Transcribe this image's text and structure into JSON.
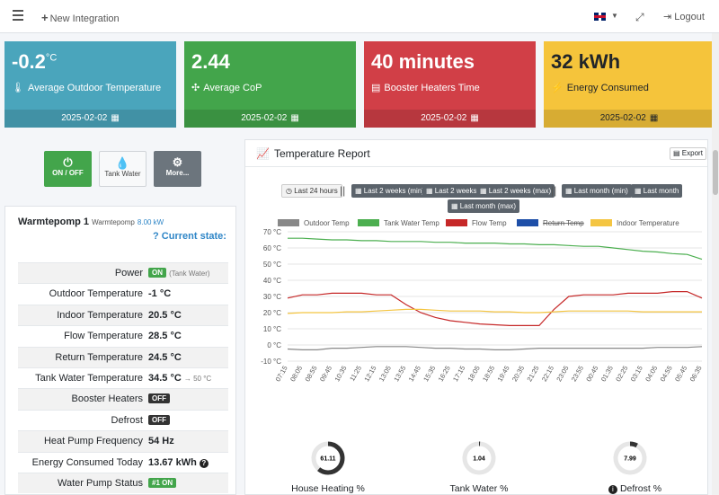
{
  "nav": {
    "new_integration": "New Integration",
    "logout": "Logout"
  },
  "cards": [
    {
      "value": "-0.2",
      "unit": "°C",
      "label": "Average Outdoor Temperature",
      "date": "2025-02-02",
      "color": "#4aa5bc"
    },
    {
      "value": "2.44",
      "unit": "",
      "label": "Average CoP",
      "date": "2025-02-02",
      "color": "#43a54b"
    },
    {
      "value": "40 minutes",
      "unit": "",
      "label": "Booster Heaters Time",
      "date": "2025-02-02",
      "color": "#d13f47"
    },
    {
      "value": "32 kWh",
      "unit": "",
      "label": "Energy Consumed",
      "date": "2025-02-02",
      "color": "#f5c43b"
    }
  ],
  "controls": {
    "on_off": "ON / OFF",
    "tank_water": "Tank Water",
    "more": "More..."
  },
  "device": {
    "name": "Warmtepomp 1",
    "subname": "Warmtepomp",
    "power": "8.00 kW",
    "current_state": "Current state:"
  },
  "state_rows": [
    {
      "key": "Power",
      "badge": "ON",
      "badge_color": "green",
      "extra": "(Tank Water)"
    },
    {
      "key": "Outdoor Temperature",
      "value": "-1 °C"
    },
    {
      "key": "Indoor Temperature",
      "value": "20.5 °C"
    },
    {
      "key": "Flow Temperature",
      "value": "28.5 °C"
    },
    {
      "key": "Return Temperature",
      "value": "24.5 °C"
    },
    {
      "key": "Tank Water Temperature",
      "value": "34.5 °C",
      "extra": "→ 50 °C"
    },
    {
      "key": "Booster Heaters",
      "badge": "OFF",
      "badge_color": "dark"
    },
    {
      "key": "Defrost",
      "badge": "OFF",
      "badge_color": "dark"
    },
    {
      "key": "Heat Pump Frequency",
      "value": "54 Hz"
    },
    {
      "key": "Energy Consumed Today",
      "value": "13.67 kWh"
    },
    {
      "key": "Water Pump Status",
      "badge": "#1 ON",
      "badge_color": "green"
    }
  ],
  "report": {
    "title": "Temperature Report",
    "export": "Export",
    "ranges": [
      "Last 24 hours",
      "Last 2 weeks (min)",
      "Last 2 weeks",
      "Last 2 weeks (max)",
      "Last month (min)",
      "Last month",
      "Last month (max)"
    ]
  },
  "chart_data": {
    "type": "line",
    "title": "",
    "ylim": [
      -10,
      70
    ],
    "yticks": [
      "70 °C",
      "60 °C",
      "50 °C",
      "40 °C",
      "30 °C",
      "20 °C",
      "10 °C",
      "0 °C",
      "-10 °C"
    ],
    "x": [
      "07:15",
      "08:05",
      "08:55",
      "09:45",
      "10:35",
      "11:25",
      "12:15",
      "13:05",
      "13:55",
      "14:45",
      "15:35",
      "16:25",
      "17:15",
      "18:05",
      "18:55",
      "19:45",
      "20:35",
      "21:25",
      "22:15",
      "23:05",
      "23:55",
      "00:45",
      "01:35",
      "02:25",
      "03:15",
      "04:05",
      "04:55",
      "05:45",
      "06:35"
    ],
    "series": [
      {
        "name": "Outdoor Temp",
        "color": "#888888",
        "hidden": false,
        "values": [
          -2.5,
          -3,
          -3,
          -2,
          -2,
          -1.5,
          -1,
          -1,
          -1,
          -1.5,
          -2,
          -2,
          -2.5,
          -2.5,
          -3,
          -3,
          -2.5,
          -2,
          -2,
          -2,
          -2,
          -2,
          -2,
          -2,
          -2,
          -1.5,
          -1.5,
          -1.5,
          -1
        ]
      },
      {
        "name": "Tank Water Temp",
        "color": "#4caf50",
        "hidden": false,
        "values": [
          66,
          66,
          65.5,
          65,
          65,
          64.5,
          64.5,
          64,
          64,
          64,
          63.5,
          63.5,
          63,
          63,
          63,
          62.5,
          62.5,
          62,
          62,
          61.5,
          61,
          61,
          60,
          59,
          58,
          57.5,
          56.5,
          56,
          53
        ]
      },
      {
        "name": "Flow Temp",
        "color": "#c62828",
        "hidden": false,
        "values": [
          29,
          31,
          31,
          32,
          32,
          32,
          31,
          31,
          25,
          20,
          17,
          15,
          14,
          13,
          12.5,
          12,
          12,
          12,
          22,
          30,
          31,
          31,
          31,
          32,
          32,
          32,
          33,
          33,
          29
        ]
      },
      {
        "name": "Return Temp",
        "color": "#1e4fa8",
        "hidden": true,
        "values": []
      },
      {
        "name": "Indoor Temperature",
        "color": "#f4c542",
        "hidden": false,
        "values": [
          19.5,
          20,
          20,
          20,
          20.5,
          20.5,
          21,
          21.5,
          22,
          22,
          21.5,
          21,
          21,
          21,
          20.5,
          20.5,
          20,
          20,
          20.5,
          21,
          21,
          21,
          21,
          21,
          20.5,
          20.5,
          20.5,
          20.5,
          20.5
        ]
      }
    ]
  },
  "gauges": [
    {
      "label": "House Heating %",
      "value": 61.11,
      "display": "61.11"
    },
    {
      "label": "Tank Water %",
      "value": 1.04,
      "display": "1.04"
    },
    {
      "label": "Defrost %",
      "value": 7.99,
      "display": "7.99"
    }
  ]
}
